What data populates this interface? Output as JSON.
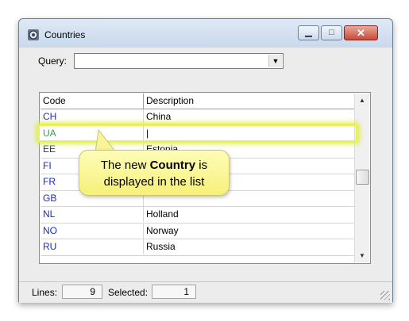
{
  "window": {
    "title": "Countries",
    "app_icon": "gear-globe-icon",
    "controls": {
      "minimize": "minimize-icon",
      "maximize": "maximize-icon",
      "close": "close-icon"
    }
  },
  "query": {
    "label": "Query:",
    "value": ""
  },
  "grid": {
    "columns": [
      "Code",
      "Description"
    ],
    "rows": [
      {
        "code": "CH",
        "description": "China"
      },
      {
        "code": "UA",
        "description": "|"
      },
      {
        "code": "EE",
        "description": "Estonia"
      },
      {
        "code": "FI",
        "description": ""
      },
      {
        "code": "FR",
        "description": ""
      },
      {
        "code": "GB",
        "description": ""
      },
      {
        "code": "NL",
        "description": "Holland"
      },
      {
        "code": "NO",
        "description": "Norway"
      },
      {
        "code": "RU",
        "description": "Russia"
      }
    ]
  },
  "callout": {
    "prefix": "The new ",
    "bold": "Country",
    "suffix": " is",
    "line2": "displayed in the list"
  },
  "status": {
    "lines_label": "Lines:",
    "lines_value": "9",
    "selected_label": "Selected:",
    "selected_value": "1"
  },
  "colors": {
    "code_text": "#1a2bd0",
    "new_code_text": "#2aa050",
    "highlight": "#e7f25a",
    "callout_bg": "#f6f07a"
  }
}
